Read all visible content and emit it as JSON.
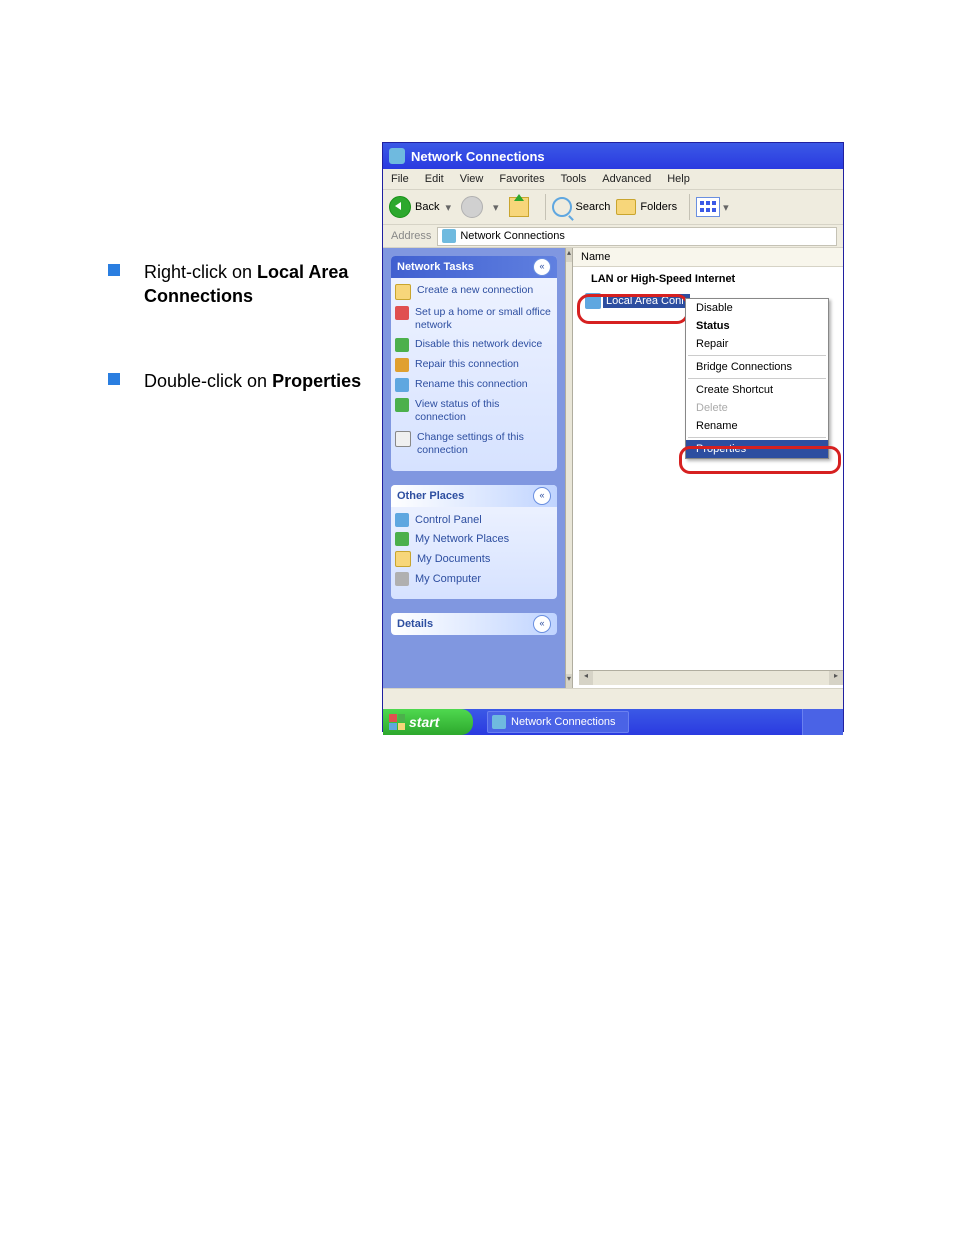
{
  "instructions": {
    "step1_prefix": "Right-click on ",
    "step1_bold": "Local Area Connections",
    "step2_prefix": "Double-click on ",
    "step2_bold": "Properties"
  },
  "window": {
    "title": "Network Connections",
    "menu": {
      "file": "File",
      "edit": "Edit",
      "view": "View",
      "favorites": "Favorites",
      "tools": "Tools",
      "advanced": "Advanced",
      "help": "Help"
    },
    "toolbar": {
      "back": "Back",
      "search": "Search",
      "folders": "Folders"
    },
    "addressbar": {
      "label": "Address",
      "value": "Network Connections"
    },
    "sidepanel": {
      "network_tasks": {
        "title": "Network Tasks",
        "items": [
          "Create a new connection",
          "Set up a home or small office network",
          "Disable this network device",
          "Repair this connection",
          "Rename this connection",
          "View status of this connection",
          "Change settings of this connection"
        ]
      },
      "other_places": {
        "title": "Other Places",
        "items": [
          "Control Panel",
          "My Network Places",
          "My Documents",
          "My Computer"
        ]
      },
      "details": {
        "title": "Details"
      }
    },
    "content": {
      "column_header": "Name",
      "category": "LAN or High-Speed Internet",
      "connection_label": "Local Area Conn"
    },
    "context_menu": {
      "disable": "Disable",
      "status": "Status",
      "repair": "Repair",
      "bridge": "Bridge Connections",
      "shortcut": "Create Shortcut",
      "delete": "Delete",
      "rename": "Rename",
      "properties": "Properties"
    },
    "taskbar": {
      "start": "start",
      "task": "Network Connections"
    }
  }
}
